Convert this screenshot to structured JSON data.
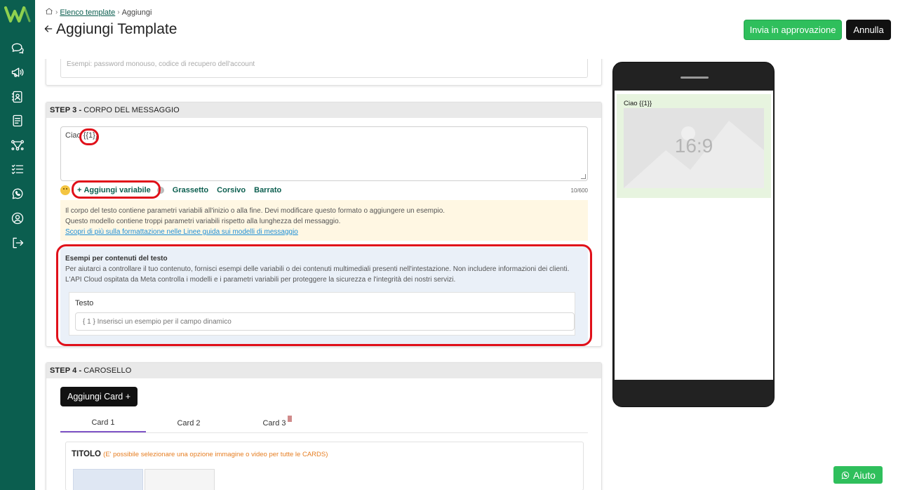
{
  "breadcrumb": {
    "parent": "Elenco template",
    "current": "Aggiungi"
  },
  "header": {
    "title": "Aggiungi Template",
    "submit_label": "Invia in approvazione",
    "cancel_label": "Annulla"
  },
  "step2_footer": {
    "placeholder": "Esempi: password monouso, codice di recupero dell'account"
  },
  "step3": {
    "step_label": "STEP 3 -",
    "title": "CORPO DEL MESSAGGIO",
    "body_prefix": "Ciao ",
    "body_variable": "{{1}}",
    "add_variable": "Aggiungi variabile",
    "bold": "Grassetto",
    "italic": "Corsivo",
    "strike": "Barrato",
    "counter": "10/600",
    "warning_lines": [
      "Il corpo del testo contiene parametri variabili all'inizio o alla fine. Devi modificare questo formato o aggiungere un esempio.",
      "Questo modello contiene troppi parametri variabili rispetto alla lunghezza del messaggio."
    ],
    "warning_link": "Scopri di più sulla formattazione nelle Linee guida sui modelli di messaggio",
    "examples": {
      "title": "Esempi per contenuti del testo",
      "lines": [
        "Per aiutarci a controllare il tuo contenuto, fornisci esempi delle variabili o dei contenuti multimediali presenti nell'intestazione. Non includere informazioni dei clienti.",
        "L'API Cloud ospitata da Meta controlla i modelli e i parametri variabili per proteggere la sicurezza e l'integrità dei nostri servizi."
      ],
      "field_label": "Testo",
      "input_placeholder": "{ 1 } Inserisci un esempio per il campo dinamico"
    }
  },
  "step4": {
    "step_label": "STEP 4 -",
    "title": "CAROSELLO",
    "add_card": "Aggiungi Card +",
    "tabs": [
      "Card 1",
      "Card 2",
      "Card 3"
    ],
    "section_title": "TITOLO",
    "section_hint": "(E' possibile selezionare una opzione immagine o video per tutte le CARDS)"
  },
  "preview": {
    "message": "Ciao {{1}}",
    "media_ratio": "16:9"
  },
  "help": {
    "label": "Aiuto"
  },
  "colors": {
    "sidebar": "#0b5e4f",
    "accent_green": "#2fbf5c",
    "highlight_red": "#e0101a",
    "tab_active": "#7f55c7"
  }
}
